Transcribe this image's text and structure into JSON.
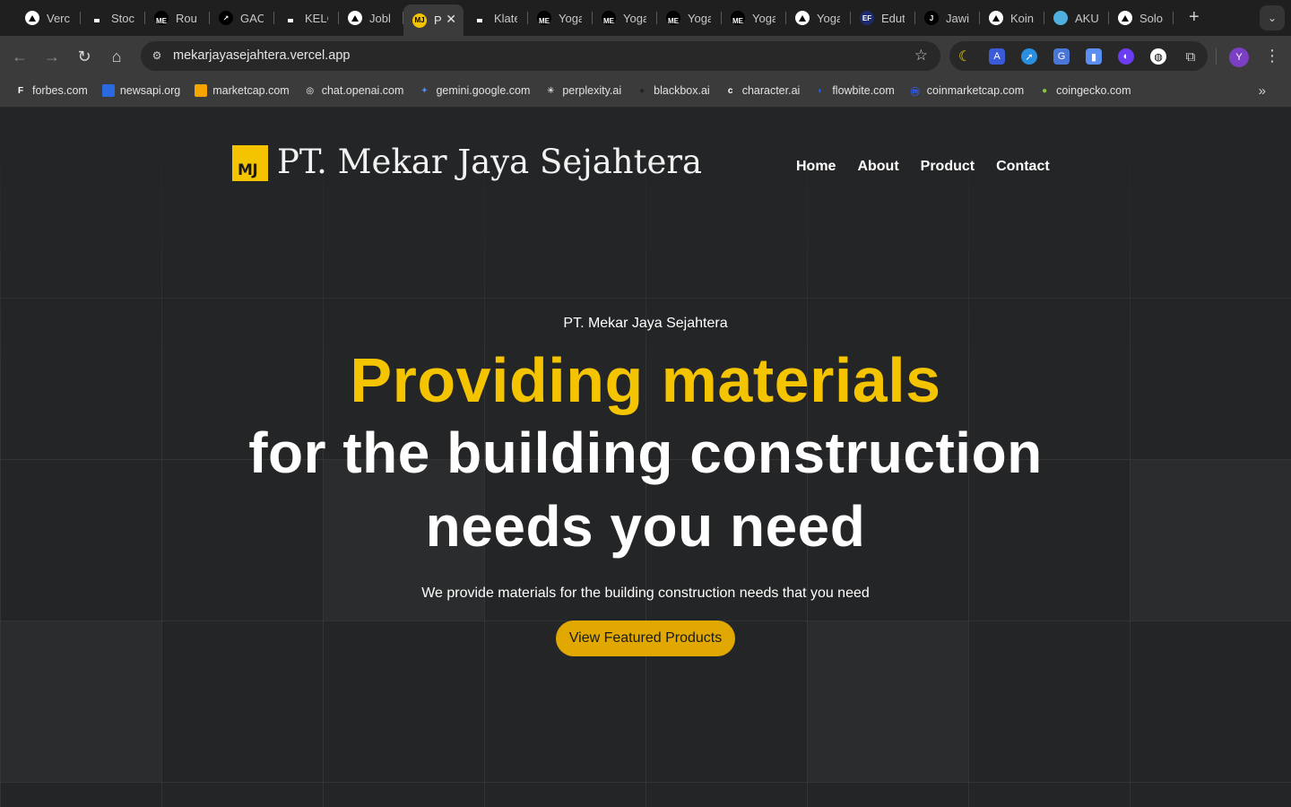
{
  "browser": {
    "tabs": [
      {
        "label": "Verc",
        "icon": "vercel-icon"
      },
      {
        "label": "Stoc",
        "icon": "dark-site-icon"
      },
      {
        "label": "Rou",
        "icon": "me-icon"
      },
      {
        "label": "GAC",
        "icon": "gac-icon"
      },
      {
        "label": "KELC",
        "icon": "dark-site-icon"
      },
      {
        "label": "Jobl",
        "icon": "vercel-icon"
      },
      {
        "label": "P",
        "icon": "mj-icon",
        "active": true
      },
      {
        "label": "Klate",
        "icon": "dark-site-icon"
      },
      {
        "label": "Yoga",
        "icon": "me-icon"
      },
      {
        "label": "Yoga",
        "icon": "me-icon"
      },
      {
        "label": "Yoga",
        "icon": "me-icon"
      },
      {
        "label": "Yoga",
        "icon": "me-icon"
      },
      {
        "label": "Yoga",
        "icon": "vercel-icon"
      },
      {
        "label": "Edut",
        "icon": "ef-icon"
      },
      {
        "label": "Jawi",
        "icon": "j-icon"
      },
      {
        "label": "Koin",
        "icon": "vercel-icon"
      },
      {
        "label": "AKU",
        "icon": "aku-icon"
      },
      {
        "label": "Solo",
        "icon": "vercel-icon"
      }
    ],
    "fav_texts": {
      "me": "ME",
      "mj": "MJ",
      "ef": "EF",
      "j": "J",
      "gac": "↗"
    },
    "url": "mekarjayasejahtera.vercel.app",
    "profile_initial": "Y",
    "bookmarks": [
      {
        "label": "forbes.com",
        "icon_text": "F",
        "color": "#ffffff"
      },
      {
        "label": "newsapi.org",
        "icon_text": "",
        "color": "#2a6ae0"
      },
      {
        "label": "marketcap.com",
        "icon_text": "",
        "color": "#f5a400"
      },
      {
        "label": "chat.openai.com",
        "icon_text": "◎",
        "color": "#ffffff"
      },
      {
        "label": "gemini.google.com",
        "icon_text": "✦",
        "color": "#4e8cf7"
      },
      {
        "label": "perplexity.ai",
        "icon_text": "✳",
        "color": "#ffffff"
      },
      {
        "label": "blackbox.ai",
        "icon_text": "●",
        "color": "#222222"
      },
      {
        "label": "character.ai",
        "icon_text": "c",
        "color": "#ffffff"
      },
      {
        "label": "flowbite.com",
        "icon_text": "◐",
        "color": "#1c64f2"
      },
      {
        "label": "coinmarketcap.com",
        "icon_text": "ⓜ",
        "color": "#3861fb"
      },
      {
        "label": "coingecko.com",
        "icon_text": "●",
        "color": "#8dc63f"
      }
    ]
  },
  "site": {
    "logo_mark": "MJ",
    "brand": "PT. Mekar Jaya Sejahtera",
    "nav": [
      "Home",
      "About",
      "Product",
      "Contact"
    ],
    "hero": {
      "eyebrow": "PT. Mekar Jaya Sejahtera",
      "line1": "Providing materials",
      "line2": "for the building construction",
      "line3": "needs you need",
      "subtitle": "We provide materials for the building construction needs that you need",
      "cta": "View Featured Products"
    },
    "colors": {
      "accent": "#f5c400",
      "button": "#e0a800",
      "background": "#242526"
    }
  }
}
